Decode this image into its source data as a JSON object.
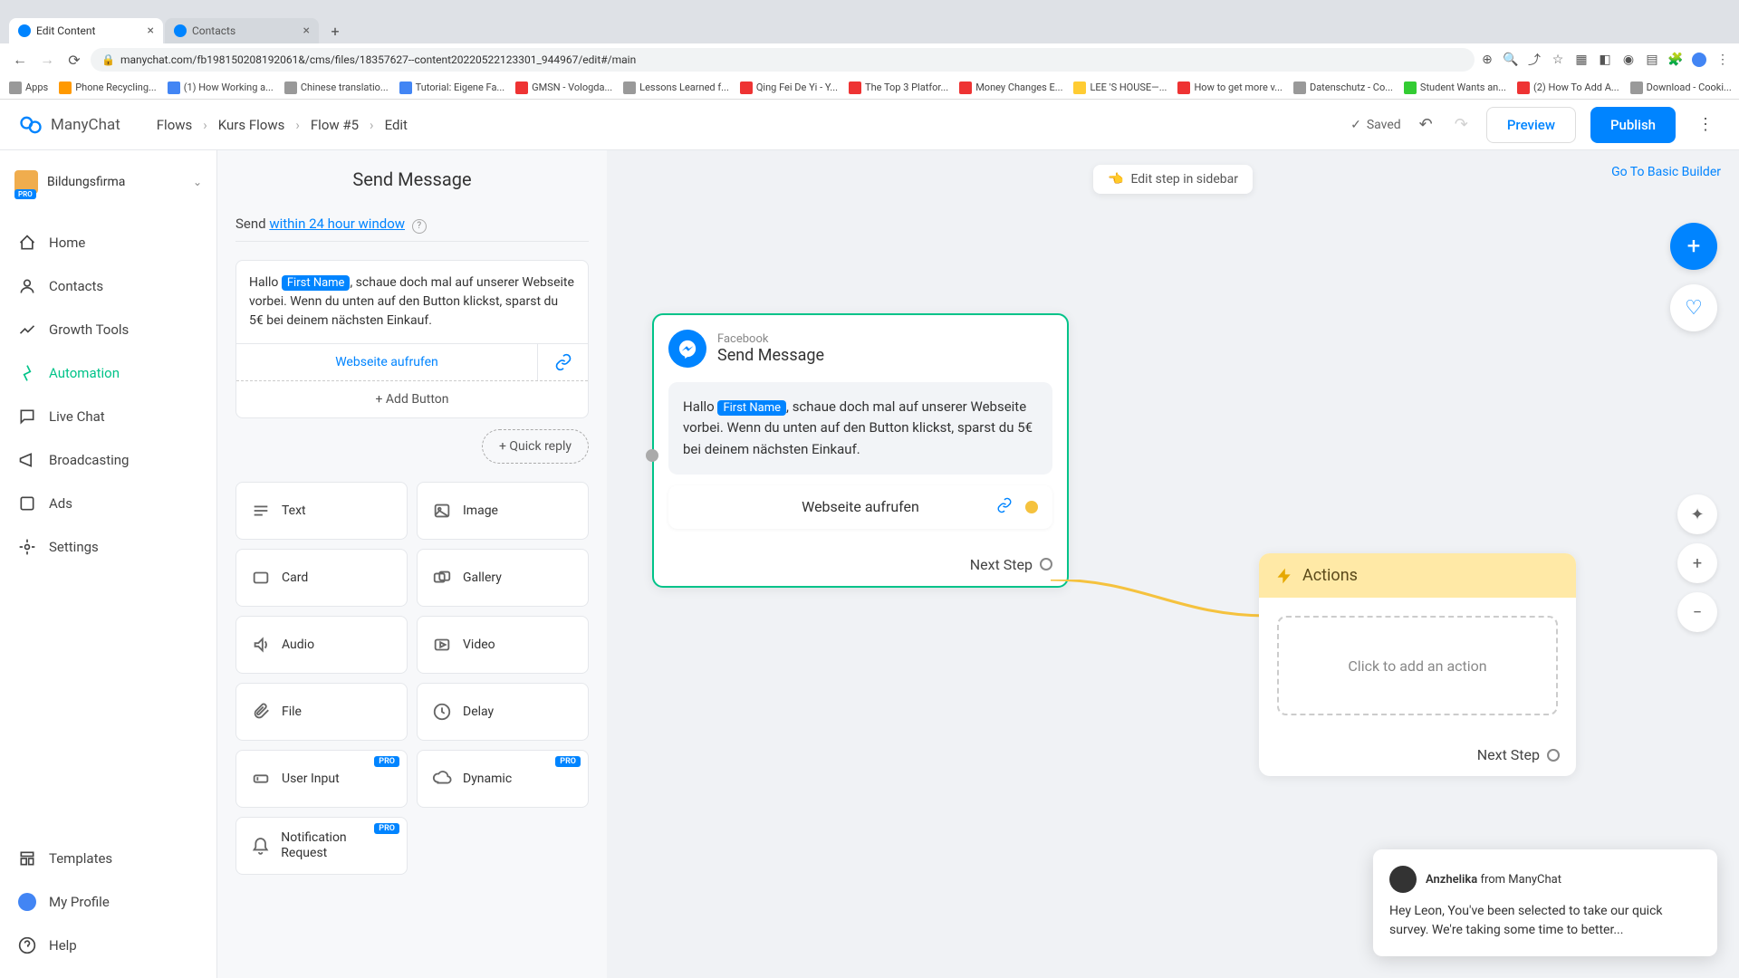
{
  "browser": {
    "tabs": [
      {
        "title": "Edit Content",
        "active": true
      },
      {
        "title": "Contacts",
        "active": false
      }
    ],
    "url": "manychat.com/fb198150208192061&/cms/files/18357627--content20220522123301_944967/edit#/main",
    "bookmarks": [
      "Apps",
      "Phone Recycling...",
      "(1) How Working a...",
      "Chinese translatio...",
      "Tutorial: Eigene Fa...",
      "GMSN - Vologda...",
      "Lessons Learned f...",
      "Qing Fei De Yi - Y...",
      "The Top 3 Platfor...",
      "Money Changes E...",
      "LEE 'S HOUSE—...",
      "How to get more v...",
      "Datenschutz - Co...",
      "Student Wants an...",
      "(2) How To Add A...",
      "Download - Cooki..."
    ]
  },
  "header": {
    "logo": "ManyChat",
    "breadcrumb": [
      "Flows",
      "Kurs Flows",
      "Flow #5",
      "Edit"
    ],
    "saved": "Saved",
    "preview": "Preview",
    "publish": "Publish"
  },
  "workspace": {
    "name": "Bildungsfirma",
    "badge": "PRO"
  },
  "nav": {
    "items": [
      "Home",
      "Contacts",
      "Growth Tools",
      "Automation",
      "Live Chat",
      "Broadcasting",
      "Ads",
      "Settings"
    ],
    "active": "Automation",
    "bottom": [
      "Templates",
      "My Profile",
      "Help"
    ]
  },
  "editor": {
    "title": "Send Message",
    "send_prefix": "Send ",
    "send_link": "within 24 hour window",
    "msg_prefix": "Hallo ",
    "msg_var": "First Name",
    "msg_suffix": ", schaue doch mal auf unserer Webseite vorbei. Wenn du unten auf den Button klickst, sparst du 5€ bei deinem nächsten Einkauf.",
    "btn_label": "Webseite aufrufen",
    "add_button": "+ Add Button",
    "quick_reply": "+ Quick reply",
    "blocks": [
      {
        "label": "Text"
      },
      {
        "label": "Image"
      },
      {
        "label": "Card"
      },
      {
        "label": "Gallery"
      },
      {
        "label": "Audio"
      },
      {
        "label": "Video"
      },
      {
        "label": "File"
      },
      {
        "label": "Delay"
      },
      {
        "label": "User Input",
        "pro": true
      },
      {
        "label": "Dynamic",
        "pro": true
      },
      {
        "label": "Notification Request",
        "pro": true
      }
    ],
    "pro_badge": "PRO"
  },
  "canvas": {
    "edit_hint": "Edit step in sidebar",
    "go_basic": "Go To Basic Builder",
    "msg_node": {
      "channel": "Facebook",
      "title": "Send Message",
      "msg_prefix": "Hallo ",
      "msg_var": "First Name",
      "msg_suffix": ", schaue doch mal auf unserer Webseite vorbei. Wenn du unten auf den Button klickst, sparst du 5€ bei deinem nächsten Einkauf.",
      "cta": "Webseite aufrufen",
      "next": "Next Step"
    },
    "actions_node": {
      "title": "Actions",
      "placeholder": "Click to add an action",
      "next": "Next Step"
    }
  },
  "chat": {
    "name": "Anzhelika",
    "from": " from ManyChat",
    "text": "Hey Leon,  You've been selected to take our quick survey. We're taking some time to better..."
  }
}
